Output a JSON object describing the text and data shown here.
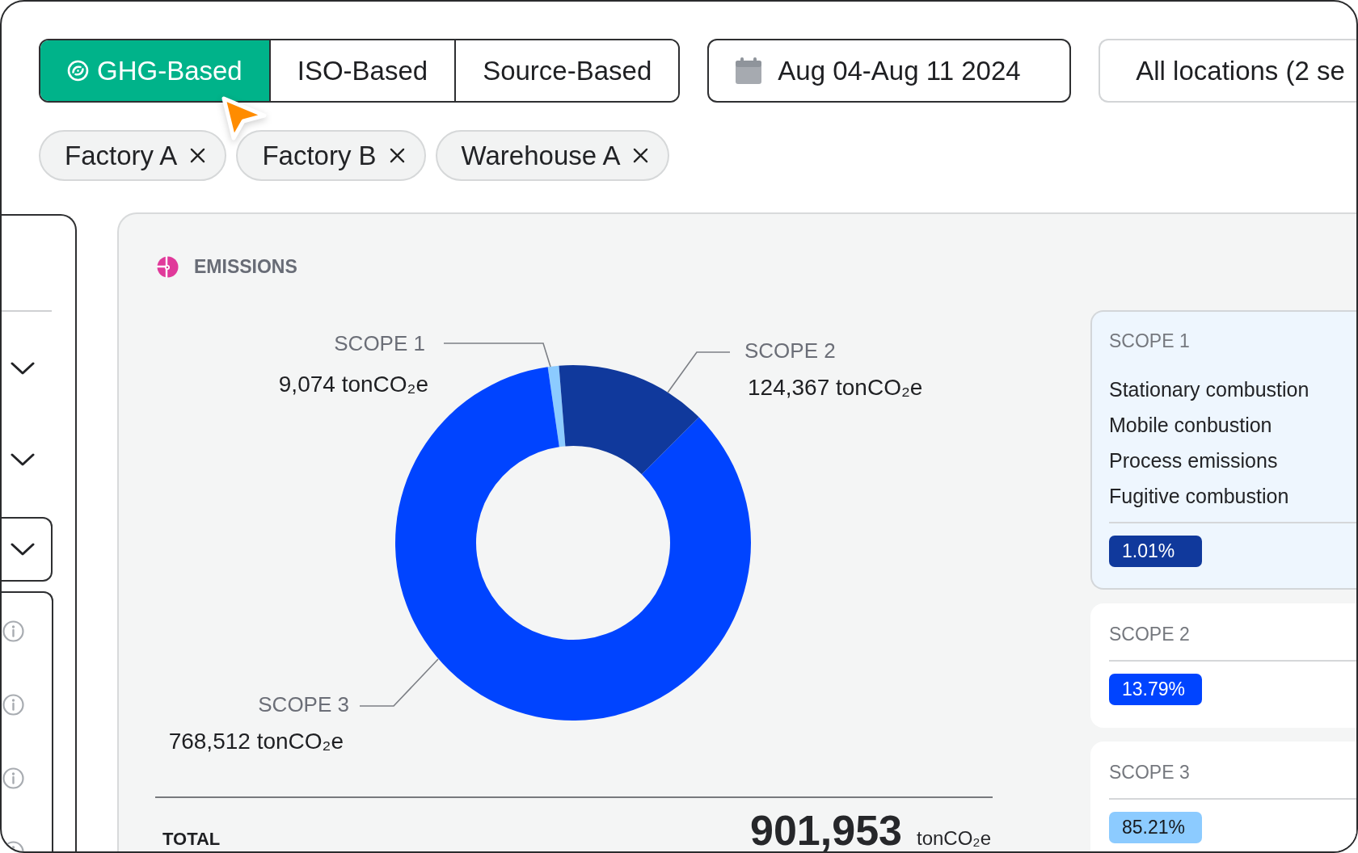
{
  "view_tabs": [
    {
      "label": "GHG-Based",
      "selected": true
    },
    {
      "label": "ISO-Based",
      "selected": false
    },
    {
      "label": "Source-Based",
      "selected": false
    }
  ],
  "date_range": {
    "label": "Aug 04-Aug 11 2024"
  },
  "location_filter": {
    "label": "All locations (2 se"
  },
  "location_chips": [
    {
      "label": "Factory A"
    },
    {
      "label": "Factory B"
    },
    {
      "label": "Warehouse A"
    }
  ],
  "emissions": {
    "title": "EMISSIONS",
    "chart_data": {
      "type": "donut",
      "categories": [
        "SCOPE 1",
        "SCOPE 2",
        "SCOPE 3"
      ],
      "values": [
        9074,
        124367,
        768512
      ],
      "value_labels": [
        "9,074 tonCO₂e",
        "124,367 tonCO₂e",
        "768,512 tonCO₂e"
      ],
      "colors": [
        "#8ccbff",
        "#10399c",
        "#0044ff"
      ]
    },
    "total": {
      "label": "TOTAL",
      "value": "901,953",
      "unit": "tonCO₂e"
    },
    "scope_cards": [
      {
        "title": "SCOPE 1",
        "selected": true,
        "items": [
          "Stationary combustion",
          "Mobile conbustion",
          "Process emissions",
          "Fugitive combustion"
        ],
        "share": "1.01%",
        "color": "#10399c"
      },
      {
        "title": "SCOPE 2",
        "selected": false,
        "share": "13.79%",
        "color": "#0044ff"
      },
      {
        "title": "SCOPE 3",
        "selected": false,
        "share": "85.21%",
        "color": "#8ccbff"
      }
    ]
  }
}
